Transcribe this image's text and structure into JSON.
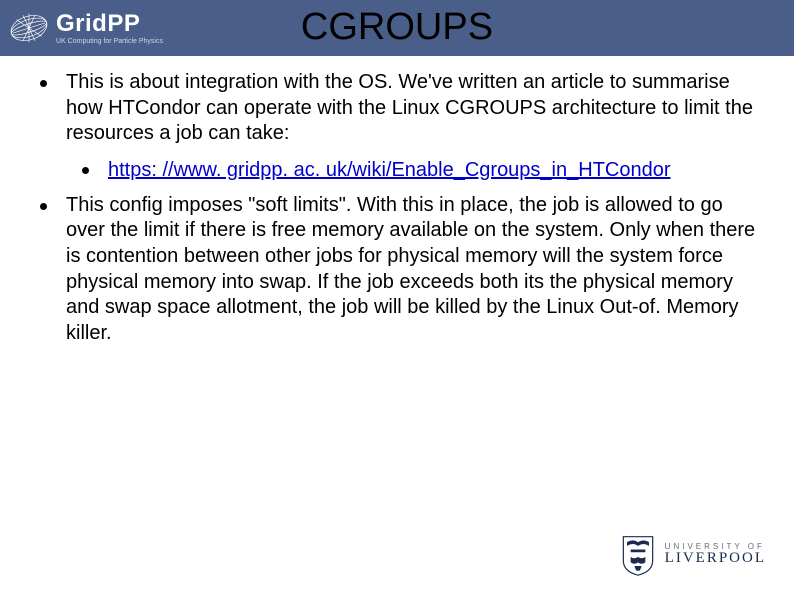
{
  "header": {
    "logo_main": "GridPP",
    "logo_sub": "UK Computing for Particle Physics",
    "title": "CGROUPS"
  },
  "content": {
    "bullet1": "This is about integration with the OS. We've written an article to summarise how HTCondor can operate with the Linux CGROUPS architecture to limit the resources a job can take:",
    "link_text": "https: //www. gridpp. ac. uk/wiki/Enable_Cgroups_in_HTCondor",
    "link_href": "https://www.gridpp.ac.uk/wiki/Enable_Cgroups_in_HTCondor",
    "bullet2": "This config imposes \"soft limits\". With this in place, the job is allowed to go over the limit if there is free memory available on the system. Only when there is contention between other jobs for physical memory will the system force physical memory into swap. If the job exceeds both its the physical memory and swap space allotment, the job will be killed by the Linux Out-of. Memory killer."
  },
  "footer": {
    "uni_top": "UNIVERSITY OF",
    "uni_bottom": "LIVERPOOL"
  }
}
